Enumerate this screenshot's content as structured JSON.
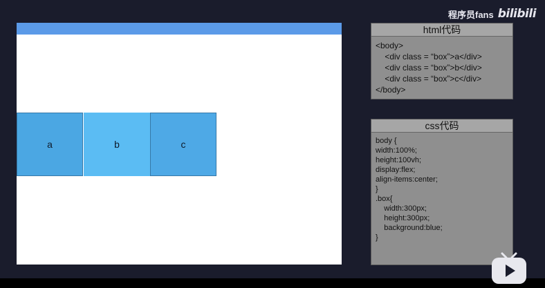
{
  "watermark": {
    "channel": "程序员fans",
    "brand": "bilibili"
  },
  "stage": {
    "boxes": [
      "a",
      "b",
      "c"
    ]
  },
  "html_panel": {
    "title": "html代码",
    "lines": [
      "<body>",
      "    <div class = “box”>a</div>",
      "    <div class = “box”>b</div>",
      "    <div class = “box”>c</div>",
      "</body>"
    ]
  },
  "css_panel": {
    "title": "css代码",
    "lines": [
      "body {",
      "width:100%;",
      "height:100vh;",
      "display:flex;",
      "align-items:center;",
      "}",
      ".box{",
      "    width:300px;",
      "    height:300px;",
      "    background:blue;",
      "}"
    ]
  }
}
